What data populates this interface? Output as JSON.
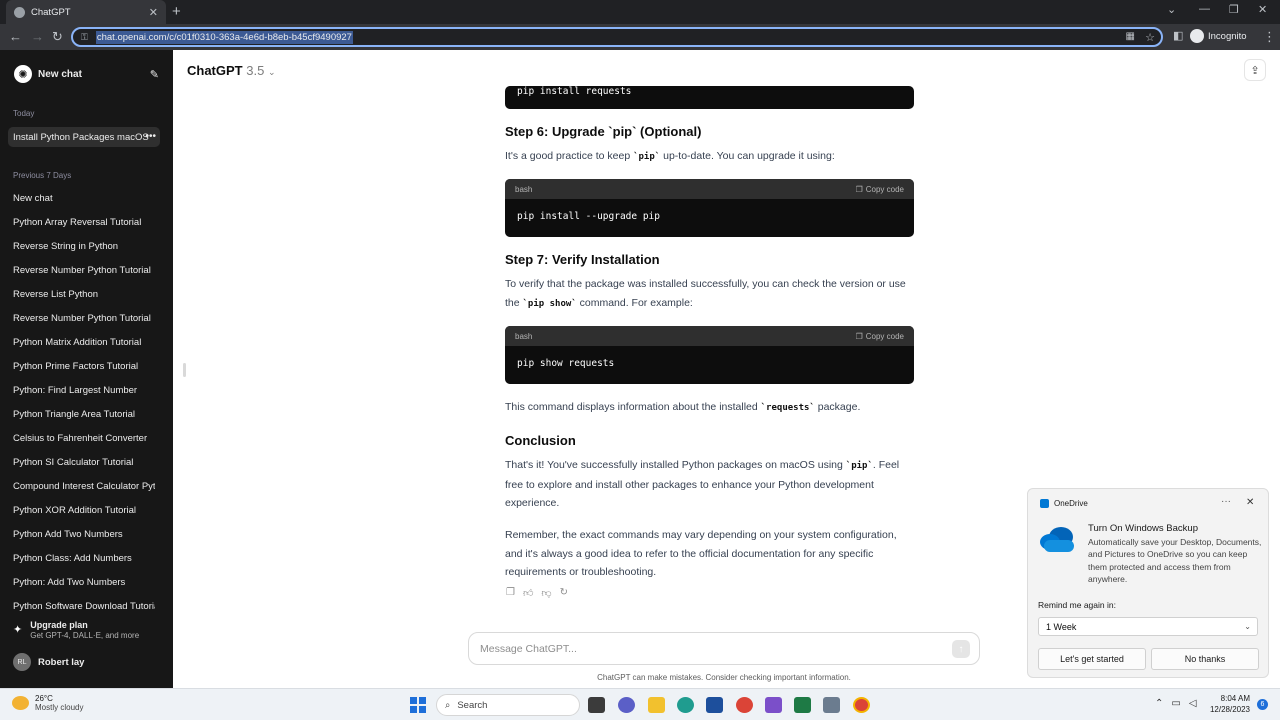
{
  "browser": {
    "tab_title": "ChatGPT",
    "new_tab": "+",
    "url": "chat.openai.com/c/c01f0310-363a-4e6d-b8eb-b45cf9490927",
    "incognito_label": "Incognito"
  },
  "sidebar": {
    "new_chat_label": "New chat",
    "today_label": "Today",
    "active_chat": "Install Python Packages macOS",
    "prev7_label": "Previous 7 Days",
    "history": [
      "New chat",
      "Python Array Reversal Tutorial",
      "Reverse String in Python",
      "Reverse Number Python Tutorial",
      "Reverse List Python",
      "Reverse Number Python Tutorial",
      "Python Matrix Addition Tutorial",
      "Python Prime Factors Tutorial",
      "Python: Find Largest Number",
      "Python Triangle Area Tutorial",
      "Celsius to Fahrenheit Converter",
      "Python SI Calculator Tutorial",
      "Compound Interest Calculator Python",
      "Python XOR Addition Tutorial",
      "Python Add Two Numbers",
      "Python Class: Add Numbers",
      "Python: Add Two Numbers",
      "Python Software Download Tutorial"
    ],
    "upgrade_title": "Upgrade plan",
    "upgrade_sub": "Get GPT-4, DALL·E, and more",
    "user_initials": "RL",
    "user_name": "Robert lay"
  },
  "header": {
    "model": "ChatGPT",
    "version": "3.5"
  },
  "content": {
    "code0": "pip install requests",
    "step6_title": "Step 6: Upgrade `pip` (Optional)",
    "step6_text_a": "It's a good practice to keep ",
    "step6_code": "`pip`",
    "step6_text_b": " up-to-date. You can upgrade it using:",
    "code_lang": "bash",
    "copy_label": "Copy code",
    "code1": "pip install --upgrade pip",
    "step7_title": "Step 7: Verify Installation",
    "step7_text_a": "To verify that the package was installed successfully, you can check the version or use the ",
    "step7_code": "`pip show`",
    "step7_text_b": " command. For example:",
    "code2": "pip show requests",
    "after_text_a": "This command displays information about the installed ",
    "after_code": "`requests`",
    "after_text_b": " package.",
    "conclusion_title": "Conclusion",
    "concl_a": "That's it! You've successfully installed Python packages on macOS using ",
    "concl_code": "`pip`",
    "concl_b": ". Feel free to explore and install other packages to enhance your Python development experience.",
    "remember": "Remember, the exact commands may vary depending on your system configuration, and it's always a good idea to refer to the official documentation for any specific requirements or troubleshooting."
  },
  "composer": {
    "placeholder": "Message ChatGPT...",
    "disclaimer": "ChatGPT can make mistakes. Consider checking important information."
  },
  "toast": {
    "app": "OneDrive",
    "more": "···",
    "title": "Turn On Windows Backup",
    "body": "Automatically save your Desktop, Documents, and Pictures to OneDrive so you can keep them protected and access them from anywhere.",
    "remind_label": "Remind me again in:",
    "remind_value": "1 Week",
    "primary_btn": "Let's get started",
    "secondary_btn": "No thanks"
  },
  "taskbar": {
    "temp": "26°C",
    "weather": "Mostly cloudy",
    "search": "Search",
    "time": "8:04 AM",
    "date": "12/28/2023",
    "notifications": "6"
  },
  "colors": {
    "sidebar_bg": "#171717",
    "accent": "#1e6fd9",
    "code_bg": "#0d0d0d"
  }
}
